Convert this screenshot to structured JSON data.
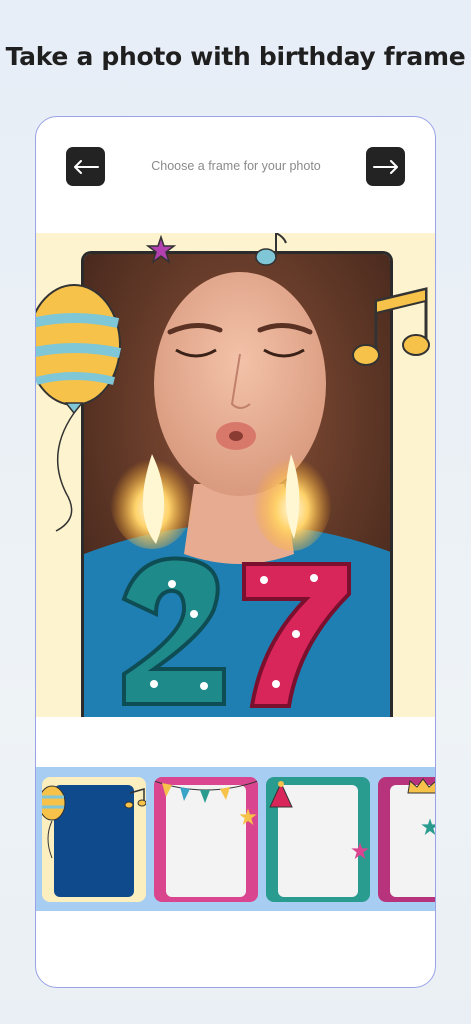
{
  "headline": "Take a photo with birthday frame",
  "topbar": {
    "title": "Choose a frame for your photo",
    "back_icon": "arrow-left-icon",
    "next_icon": "arrow-right-icon"
  },
  "preview": {
    "frame_number": "27",
    "frame_theme": "birthday-balloon-music"
  },
  "frames": [
    {
      "theme": "balloon-music",
      "inner_color": "#0e4a8c",
      "border_color": "#fbeebf"
    },
    {
      "theme": "bunting-stars",
      "inner_color": "#f3f3f3",
      "border_color": "#d9468f"
    },
    {
      "theme": "party-hat",
      "inner_color": "#f3f3f3",
      "border_color": "#2a9c8f"
    },
    {
      "theme": "crown-stars",
      "inner_color": "#f3f3f3",
      "border_color": "#b7347d"
    }
  ]
}
